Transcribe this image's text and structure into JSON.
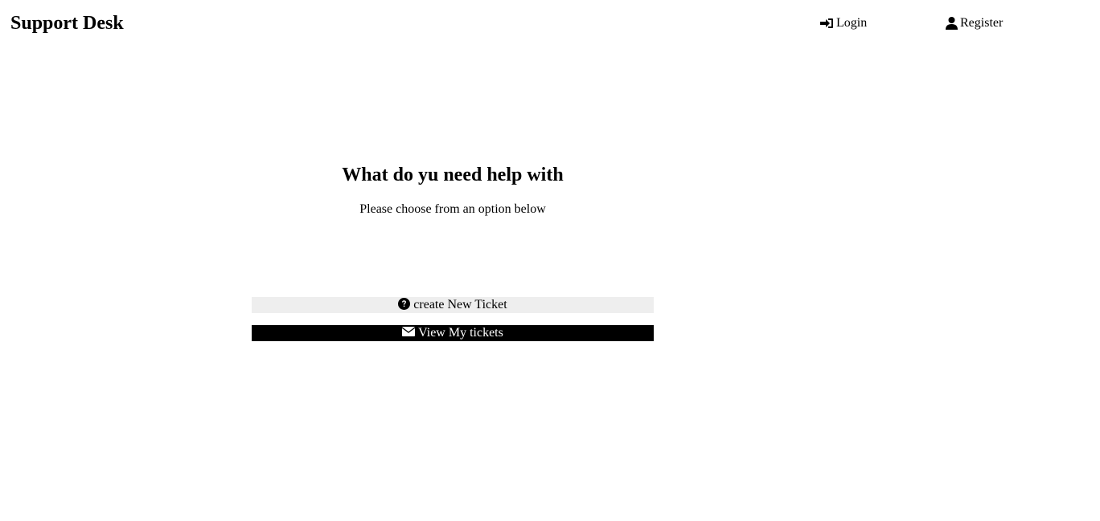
{
  "header": {
    "brand": "Support Desk",
    "nav": {
      "login_label": "Login",
      "login_icon": "sign-in-icon",
      "register_label": "Register",
      "register_icon": "user-icon"
    }
  },
  "main": {
    "title": "What do yu need help with",
    "subtitle": "Please choose from an option below",
    "actions": {
      "create_ticket": {
        "label": "create New Ticket",
        "icon": "question-circle-icon",
        "background": "#eeeeee",
        "color": "#000000"
      },
      "view_tickets": {
        "label": "View My tickets",
        "icon": "envelope-icon",
        "background": "#000000",
        "color": "#ffffff"
      }
    }
  }
}
